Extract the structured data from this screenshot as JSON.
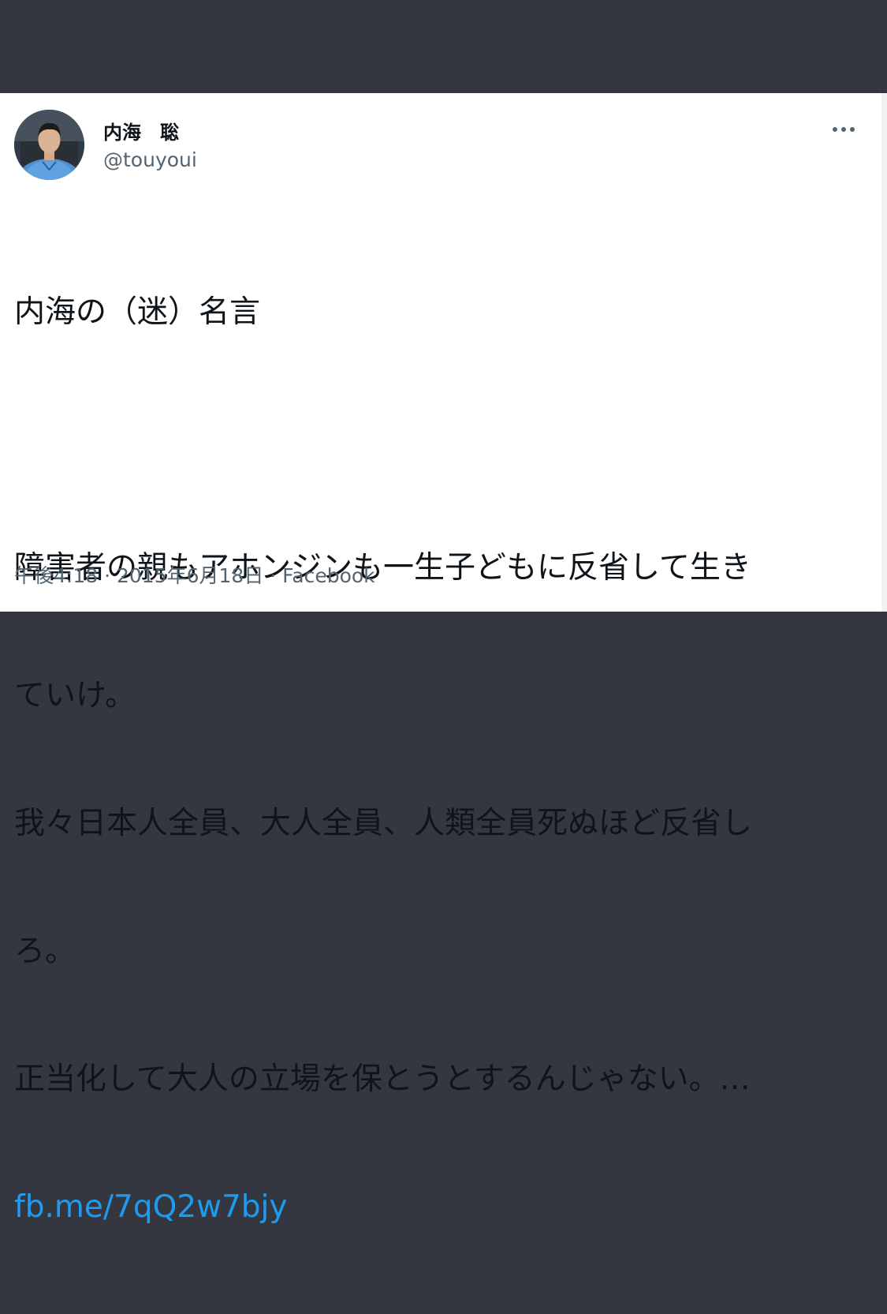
{
  "tweet": {
    "author": {
      "display_name": "内海　聡",
      "handle": "@touyoui"
    },
    "more_icon": "more-horizontal-icon",
    "text_lines": [
      "内海の（迷）名言",
      "",
      "障害者の親もアホンジンも一生子どもに反省して生き",
      "ていけ。",
      "我々日本人全員、大人全員、人類全員死ぬほど反省し",
      "ろ。",
      "正当化して大人の立場を保とうとするんじゃない。…"
    ],
    "link": "fb.me/7qQ2w7bjy",
    "time": "午後4:18",
    "date": "2015年6月18日",
    "source": "Facebook",
    "separator": " · "
  },
  "colors": {
    "background_band": "#343740",
    "card": "#ffffff",
    "text_primary": "#0f1419",
    "text_secondary": "#536471",
    "link": "#1d9bf0"
  }
}
